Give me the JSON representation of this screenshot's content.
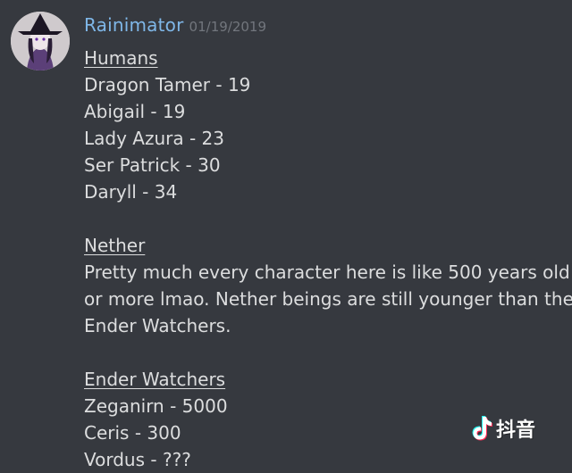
{
  "message": {
    "author": "Rainimator",
    "timestamp": "01/19/2019",
    "colors": {
      "background": "#36393f",
      "username": "#7fb7e8",
      "timestamp": "#72767d",
      "text": "#dcddde"
    },
    "sections": {
      "humans": {
        "heading": "Humans",
        "lines": [
          "Dragon Tamer - 19",
          "Abigail - 19",
          "Lady Azura - 23",
          "Ser Patrick - 30",
          "Daryll - 34"
        ]
      },
      "nether": {
        "heading": "Nether",
        "lines": [
          "Pretty much every character here is like 500 years old",
          "or more lmao. Nether beings are still younger than the",
          "Ender Watchers."
        ]
      },
      "ender": {
        "heading": "Ender Watchers",
        "lines": [
          "Zeganirn - 5000",
          "Ceris - 300",
          "Vordus - ???"
        ]
      }
    }
  },
  "watermark": {
    "icon": "tiktok-icon",
    "text": "抖音"
  }
}
